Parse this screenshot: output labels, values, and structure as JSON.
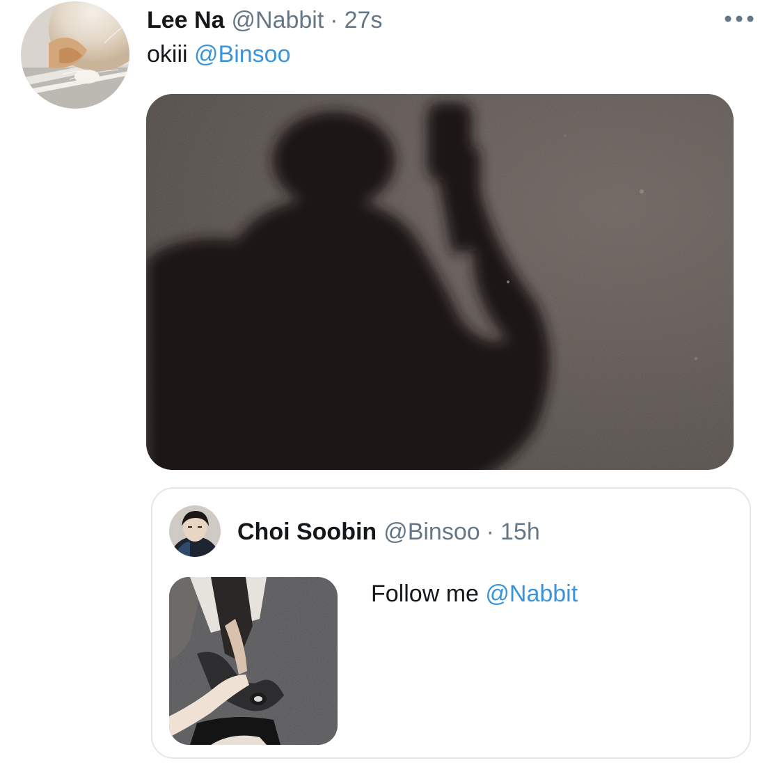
{
  "tweet": {
    "author": {
      "display_name": "Lee Na",
      "handle": "@Nabbit",
      "avatar_icon": "cat-photo-avatar"
    },
    "separator": "·",
    "timestamp": "27s",
    "text": "okiii",
    "mention": "@Binsoo",
    "media_icon": "shadow-photo",
    "more_icon": "more-horizontal-icon"
  },
  "quoted_tweet": {
    "author": {
      "display_name": "Choi Soobin",
      "handle": "@Binsoo",
      "avatar_icon": "person-photo-avatar"
    },
    "separator": "·",
    "timestamp": "15h",
    "text": "Follow me",
    "mention": "@Nabbit",
    "media_icon": "holding-hands-photo"
  },
  "colors": {
    "text_primary": "#14171a",
    "text_secondary": "#657786",
    "link": "#3b94d9",
    "border": "#e1e8ed"
  }
}
